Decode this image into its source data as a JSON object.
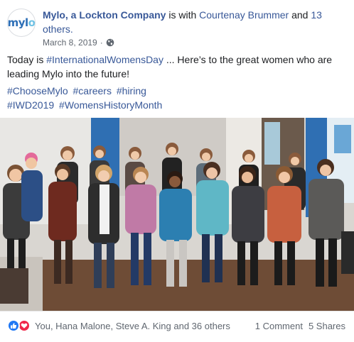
{
  "post": {
    "author": "Mylo, a Lockton Company",
    "with_text": "is with",
    "tagged_person": "Courtenay Brummer",
    "and_text": "and",
    "others": "13 others.",
    "date": "March 8, 2019",
    "separator": "·",
    "privacy_icon": "globe-icon",
    "logo_text_prefix": "myl",
    "logo_text_suffix": "o",
    "message_prefix": "Today is ",
    "message_hashtag": "#InternationalWomensDay",
    "message_suffix": " ... Here’s to the great women who are leading Mylo into the future!",
    "hashtags": [
      "#ChooseMylo",
      "#careers",
      "#hiring",
      "#IWD2019",
      "#WomensHistoryMonth"
    ]
  },
  "footer": {
    "reaction_icons": [
      "like-icon",
      "love-icon"
    ],
    "reaction_names": "You, Hana Malone, Steve A. King and 36 others",
    "comments": "1 Comment",
    "shares": "5 Shares"
  },
  "colors": {
    "link": "#385898",
    "like": "#2078f4",
    "love": "#f0284a",
    "meta": "#606770"
  }
}
